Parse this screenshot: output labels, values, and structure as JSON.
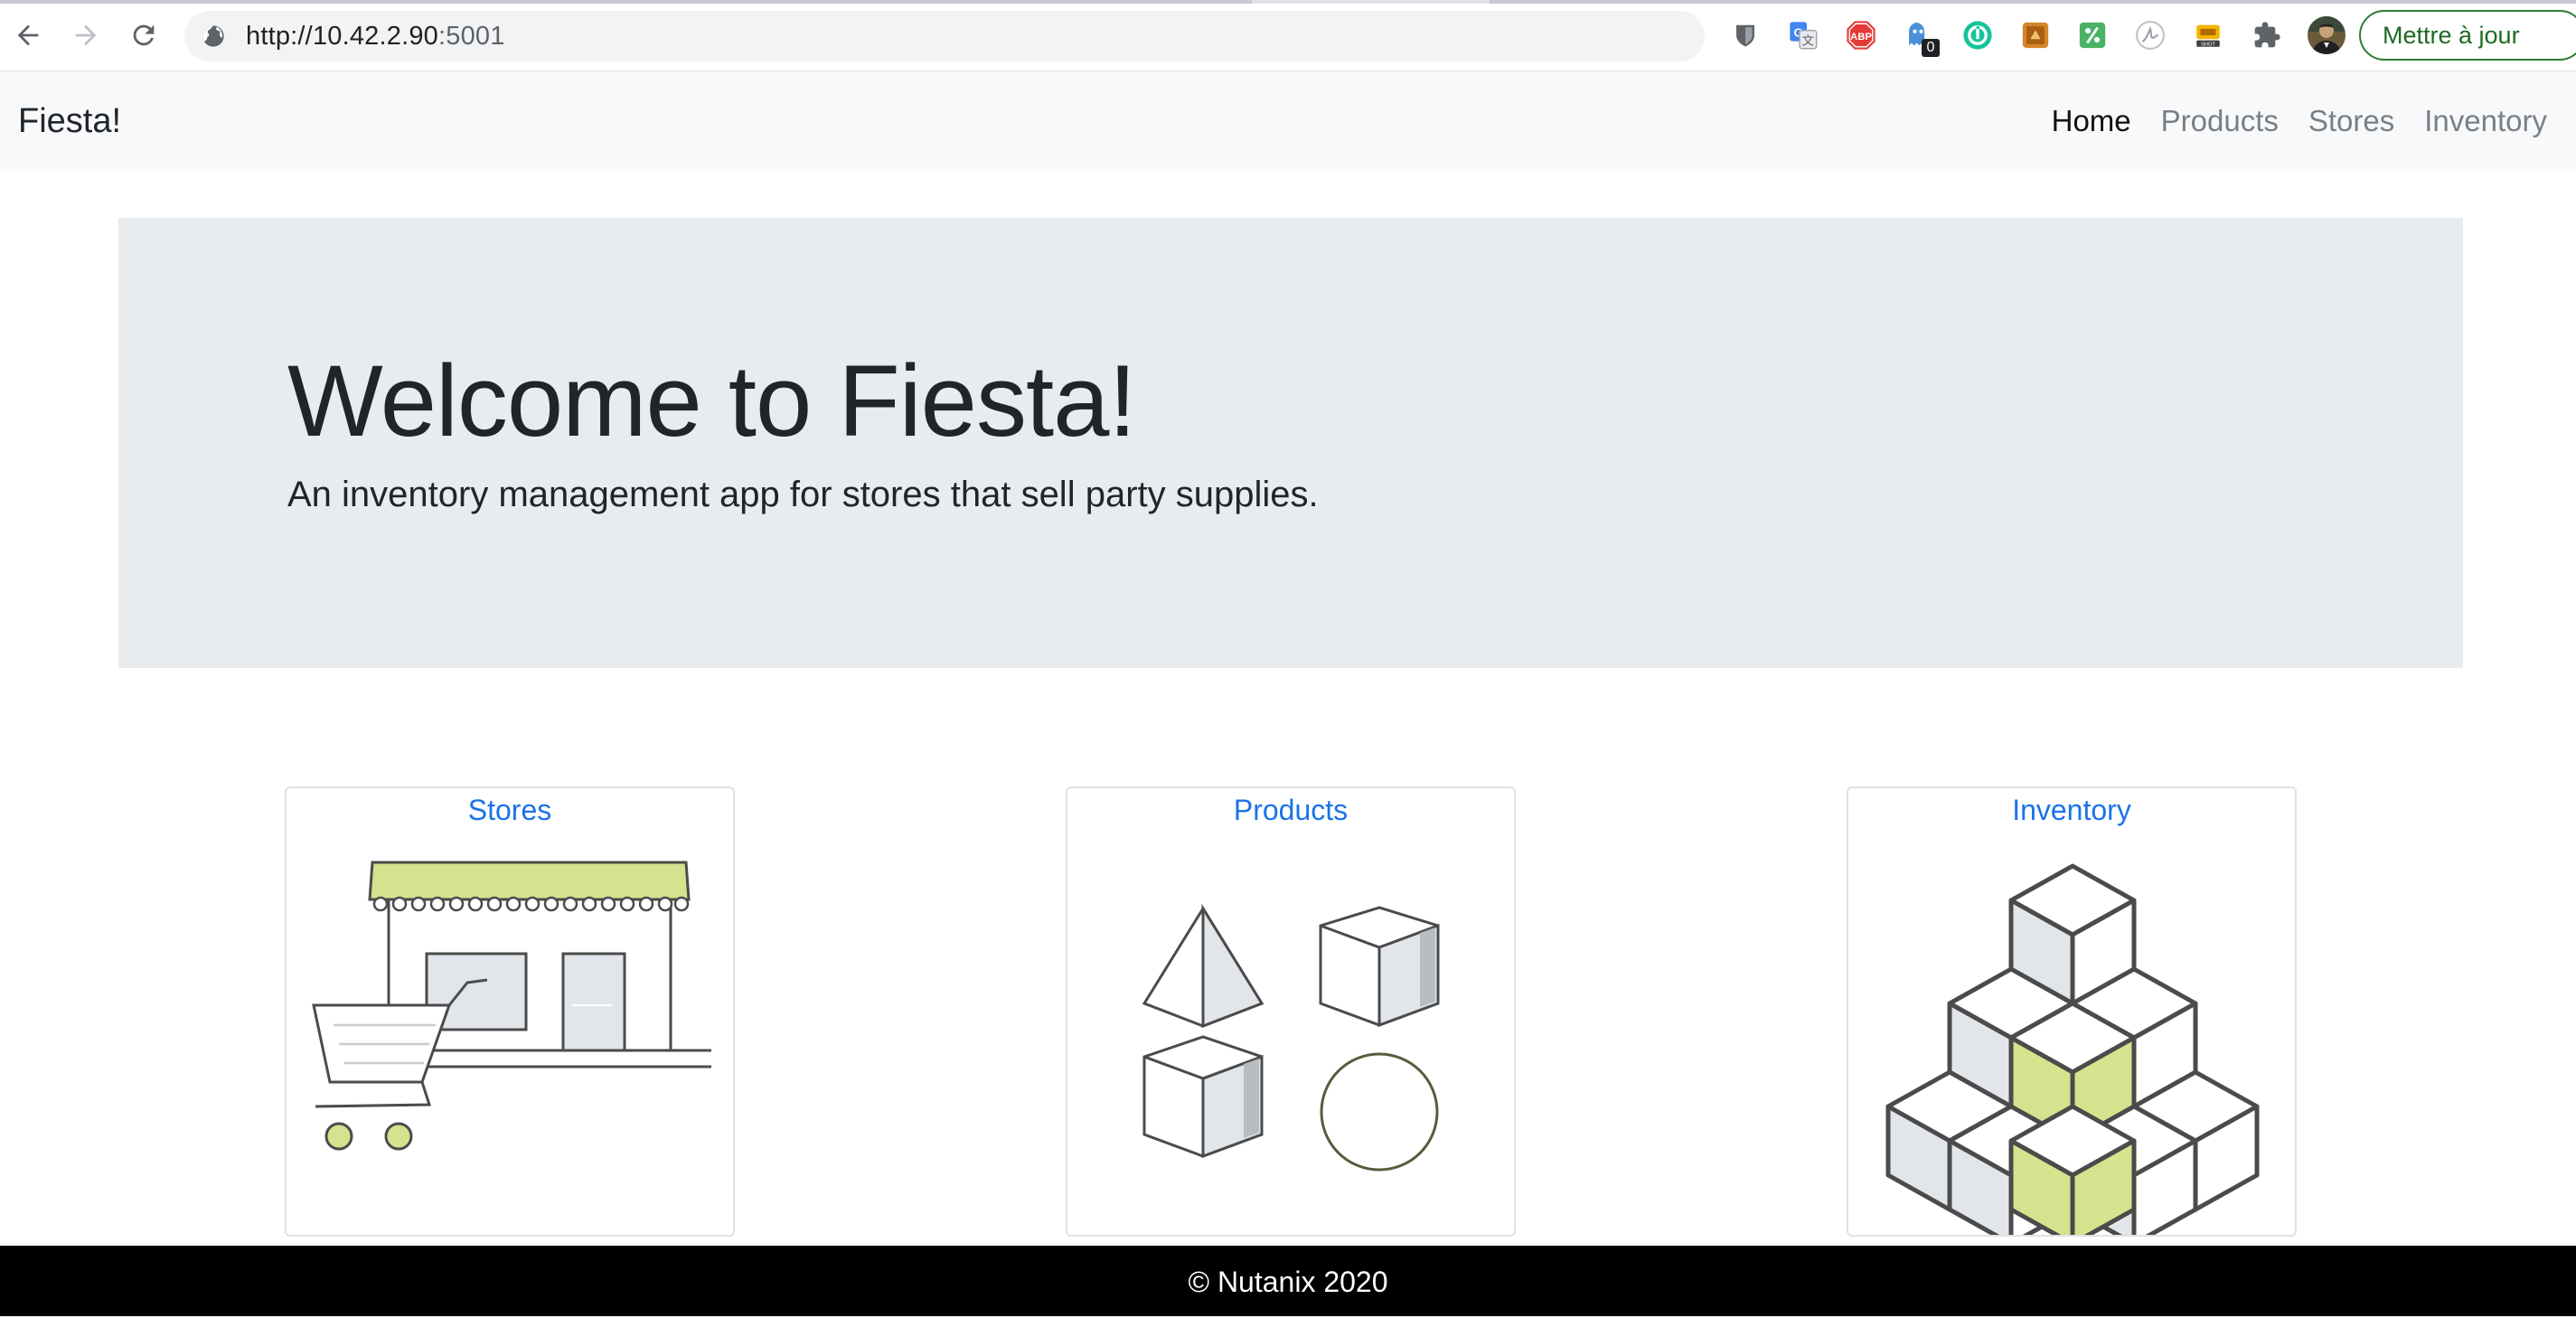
{
  "browser": {
    "url_host": "http://10.42.2.90",
    "url_port": ":5001",
    "update_button": "Mettre à jour",
    "extension_badge": "0",
    "extensions": [
      "password-manager-icon",
      "google-translate-icon",
      "adblock-icon",
      "ghostery-icon",
      "grammar-icon",
      "bookmark-icon",
      "coupon-icon",
      "signature-icon",
      "capture-icon",
      "puzzle-icon",
      "profile-avatar"
    ]
  },
  "navbar": {
    "brand": "Fiesta!",
    "links": [
      "Home",
      "Products",
      "Stores",
      "Inventory"
    ],
    "active": "Home"
  },
  "jumbotron": {
    "title": "Welcome to Fiesta!",
    "subtitle": "An inventory management app for stores that sell party supplies."
  },
  "cards": [
    {
      "title": "Stores",
      "icon": "storefront-icon"
    },
    {
      "title": "Products",
      "icon": "shapes-icon"
    },
    {
      "title": "Inventory",
      "icon": "stacked-cubes-icon"
    }
  ],
  "colors": {
    "accent_green": "#d6e28e",
    "link_blue": "#1a73e8",
    "outline_gray": "#4b4b4b",
    "jumbotron_bg": "#e9ecef"
  },
  "footer": {
    "text": "© Nutanix 2020"
  }
}
